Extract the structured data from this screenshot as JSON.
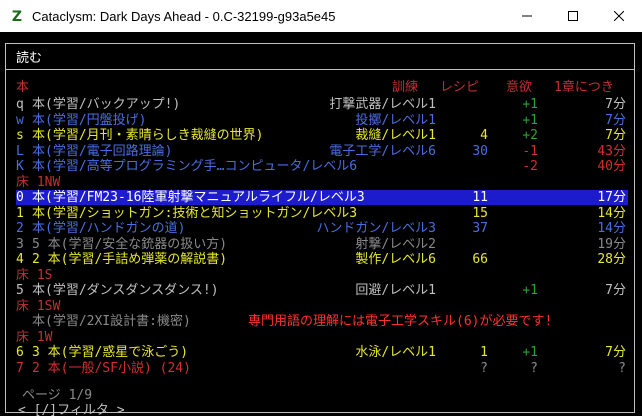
{
  "window": {
    "title": "Cataclysm: Dark Days Ahead - 0.C-32199-g93a5e45",
    "app_icon_letter": "Z"
  },
  "menu_title": "読む",
  "columns": {
    "book": "本",
    "training": "訓練",
    "recipes": "レシピ",
    "fun": "意欲",
    "per_chapter": "1章につき"
  },
  "sections": [
    {
      "title": "",
      "rows": [
        {
          "key": "q",
          "name": "本(学習/バックアップ!)",
          "skill": "打撃武器/レベル1",
          "recipes": "",
          "fun": "+1",
          "time": "7分",
          "color": "#c0c0c0",
          "skill_color": "#c0c0c0",
          "fun_color": "#30a030",
          "time_color": "#c0c0c0"
        },
        {
          "key": "w",
          "name": "本(学習/円盤投げ)",
          "skill": "投擲/レベル1",
          "recipes": "",
          "fun": "+1",
          "time": "7分",
          "color": "#4a6ee0",
          "skill_color": "#4a6ee0",
          "fun_color": "#30a030",
          "time_color": "#4a6ee0"
        },
        {
          "key": "s",
          "name": "本(学習/月刊・素晴らしき裁縫の世界)",
          "skill": "裁縫/レベル1",
          "recipes": "4",
          "fun": "+2",
          "time": "7分",
          "color": "#e8e830",
          "skill_color": "#e8e830",
          "fun_color": "#30a030",
          "time_color": "#e8e830"
        },
        {
          "key": "L",
          "name": "本(学習/電子回路理論)",
          "skill": "電子工学/レベル6",
          "recipes": "30",
          "fun": "-1",
          "time": "43分",
          "color": "#4a6ee0",
          "skill_color": "#4a6ee0",
          "fun_color": "#d03030",
          "time_color": "#d03030"
        },
        {
          "key": "K",
          "name": "本(学習/高等プログラミング手…コンピュータ/レベル6",
          "skill": "",
          "recipes": "",
          "fun": "-2",
          "time": "40分",
          "color": "#4a6ee0",
          "skill_color": "#4a6ee0",
          "fun_color": "#d03030",
          "time_color": "#d03030"
        }
      ]
    },
    {
      "title": "床 1NW",
      "rows": [
        {
          "key": "0",
          "name": "本(学習/FM23-16陸軍射撃マニュアルライフル/レベル3",
          "skill": "",
          "recipes": "11",
          "fun": "",
          "time": "17分",
          "color": "#ffffff",
          "skill_color": "#ffffff",
          "fun_color": "#ffffff",
          "time_color": "#ffffff",
          "selected": true
        },
        {
          "key": "1",
          "name": "本(学習/ショットガン:技術と知ショットガン/レベル3",
          "skill": "",
          "recipes": "15",
          "fun": "",
          "time": "14分",
          "color": "#e8e830",
          "skill_color": "#e8e830",
          "fun_color": "#e8e830",
          "time_color": "#e8e830"
        },
        {
          "key": "2",
          "name": "本(学習/ハンドガンの道)",
          "skill": "ハンドガン/レベル3",
          "recipes": "37",
          "fun": "",
          "time": "14分",
          "color": "#4a6ee0",
          "skill_color": "#4a6ee0",
          "fun_color": "#4a6ee0",
          "time_color": "#4a6ee0"
        },
        {
          "key": "3",
          "name": "5 本(学習/安全な銃器の扱い方)",
          "skill": "射撃/レベル2",
          "recipes": "",
          "fun": "",
          "time": "19分",
          "color": "#8a8a8a",
          "skill_color": "#8a8a8a",
          "fun_color": "#8a8a8a",
          "time_color": "#8a8a8a"
        },
        {
          "key": "4",
          "name": "2 本(学習/手詰め弾薬の解説書)",
          "skill": "製作/レベル6",
          "recipes": "66",
          "fun": "",
          "time": "28分",
          "color": "#e8e830",
          "skill_color": "#e8e830",
          "fun_color": "#e8e830",
          "time_color": "#e8e830"
        }
      ]
    },
    {
      "title": "床 1S",
      "rows": [
        {
          "key": "5",
          "name": "本(学習/ダンスダンスダンス!)",
          "skill": "回避/レベル1",
          "recipes": "",
          "fun": "+1",
          "time": "7分",
          "color": "#c0c0c0",
          "skill_color": "#c0c0c0",
          "fun_color": "#30a030",
          "time_color": "#c0c0c0"
        }
      ]
    },
    {
      "title": "床 1SW",
      "rows": [
        {
          "key": "",
          "name": "本(学習/2XI設計書:機密)",
          "skill": "専門用語の理解には電子工学スキル(6)が必要です!",
          "recipes": "",
          "fun": "",
          "time": "",
          "color": "#8a8a8a",
          "skill_color": "#ff3030",
          "fun_color": "#8a8a8a",
          "time_color": "#8a8a8a",
          "warning": true
        }
      ]
    },
    {
      "title": "床 1W",
      "rows": [
        {
          "key": "6",
          "name": "3 本(学習/惑星で泳ごう)",
          "skill": "水泳/レベル1",
          "recipes": "1",
          "fun": "+1",
          "time": "7分",
          "color": "#e8e830",
          "skill_color": "#e8e830",
          "fun_color": "#30a030",
          "time_color": "#e8e830"
        },
        {
          "key": "7",
          "name": "2 本(一般/SF小説) (24)",
          "skill": "",
          "recipes": "?",
          "fun": "?",
          "time": "?",
          "color": "#d03030",
          "skill_color": "#d03030",
          "fun_color": "#8a8a8a",
          "time_color": "#8a8a8a",
          "unknown": true
        }
      ]
    }
  ],
  "footer": {
    "page": "ページ 1/9",
    "filter": "< [/]フィルタ >"
  }
}
